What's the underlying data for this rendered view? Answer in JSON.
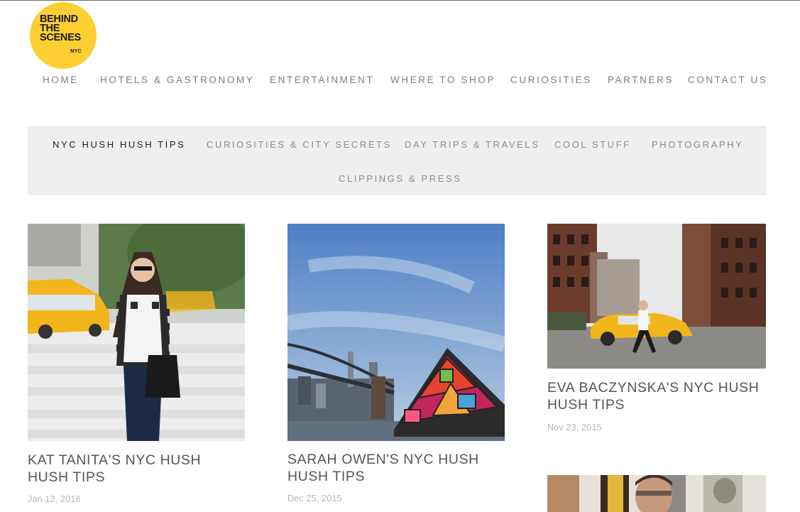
{
  "logo": {
    "line1": "BEHIND",
    "line2": "THE",
    "line3": "SCENES",
    "line4": "NYC"
  },
  "main_nav": {
    "items": [
      "HOME",
      "HOTELS & GASTRONOMY",
      "ENTERTAINMENT",
      "WHERE TO SHOP",
      "CURIOSITIES",
      "PARTNERS",
      "CONTACT US"
    ]
  },
  "categories": {
    "items": [
      "NYC HUSH HUSH TIPS",
      "CURIOSITIES & CITY SECRETS",
      "DAY TRIPS & TRAVELS",
      "COOL STUFF",
      "PHOTOGRAPHY",
      "CLIPPINGS & PRESS"
    ],
    "active": "NYC HUSH HUSH TIPS"
  },
  "posts": [
    {
      "title": "KAT TANITA'S NYC HUSH HUSH TIPS",
      "date": "Jan 12, 2016"
    },
    {
      "title": "SARAH OWEN'S NYC HUSH HUSH TIPS",
      "date": "Dec 25, 2015"
    },
    {
      "title": "EVA BACZYNSKA'S NYC HUSH HUSH TIPS",
      "date": "Nov 23, 2015"
    },
    {
      "title": "",
      "date": ""
    }
  ],
  "colors": {
    "logo_yellow": "#fccf33",
    "taxi_yellow": "#f2b51c",
    "bar_bg": "#efefef"
  }
}
